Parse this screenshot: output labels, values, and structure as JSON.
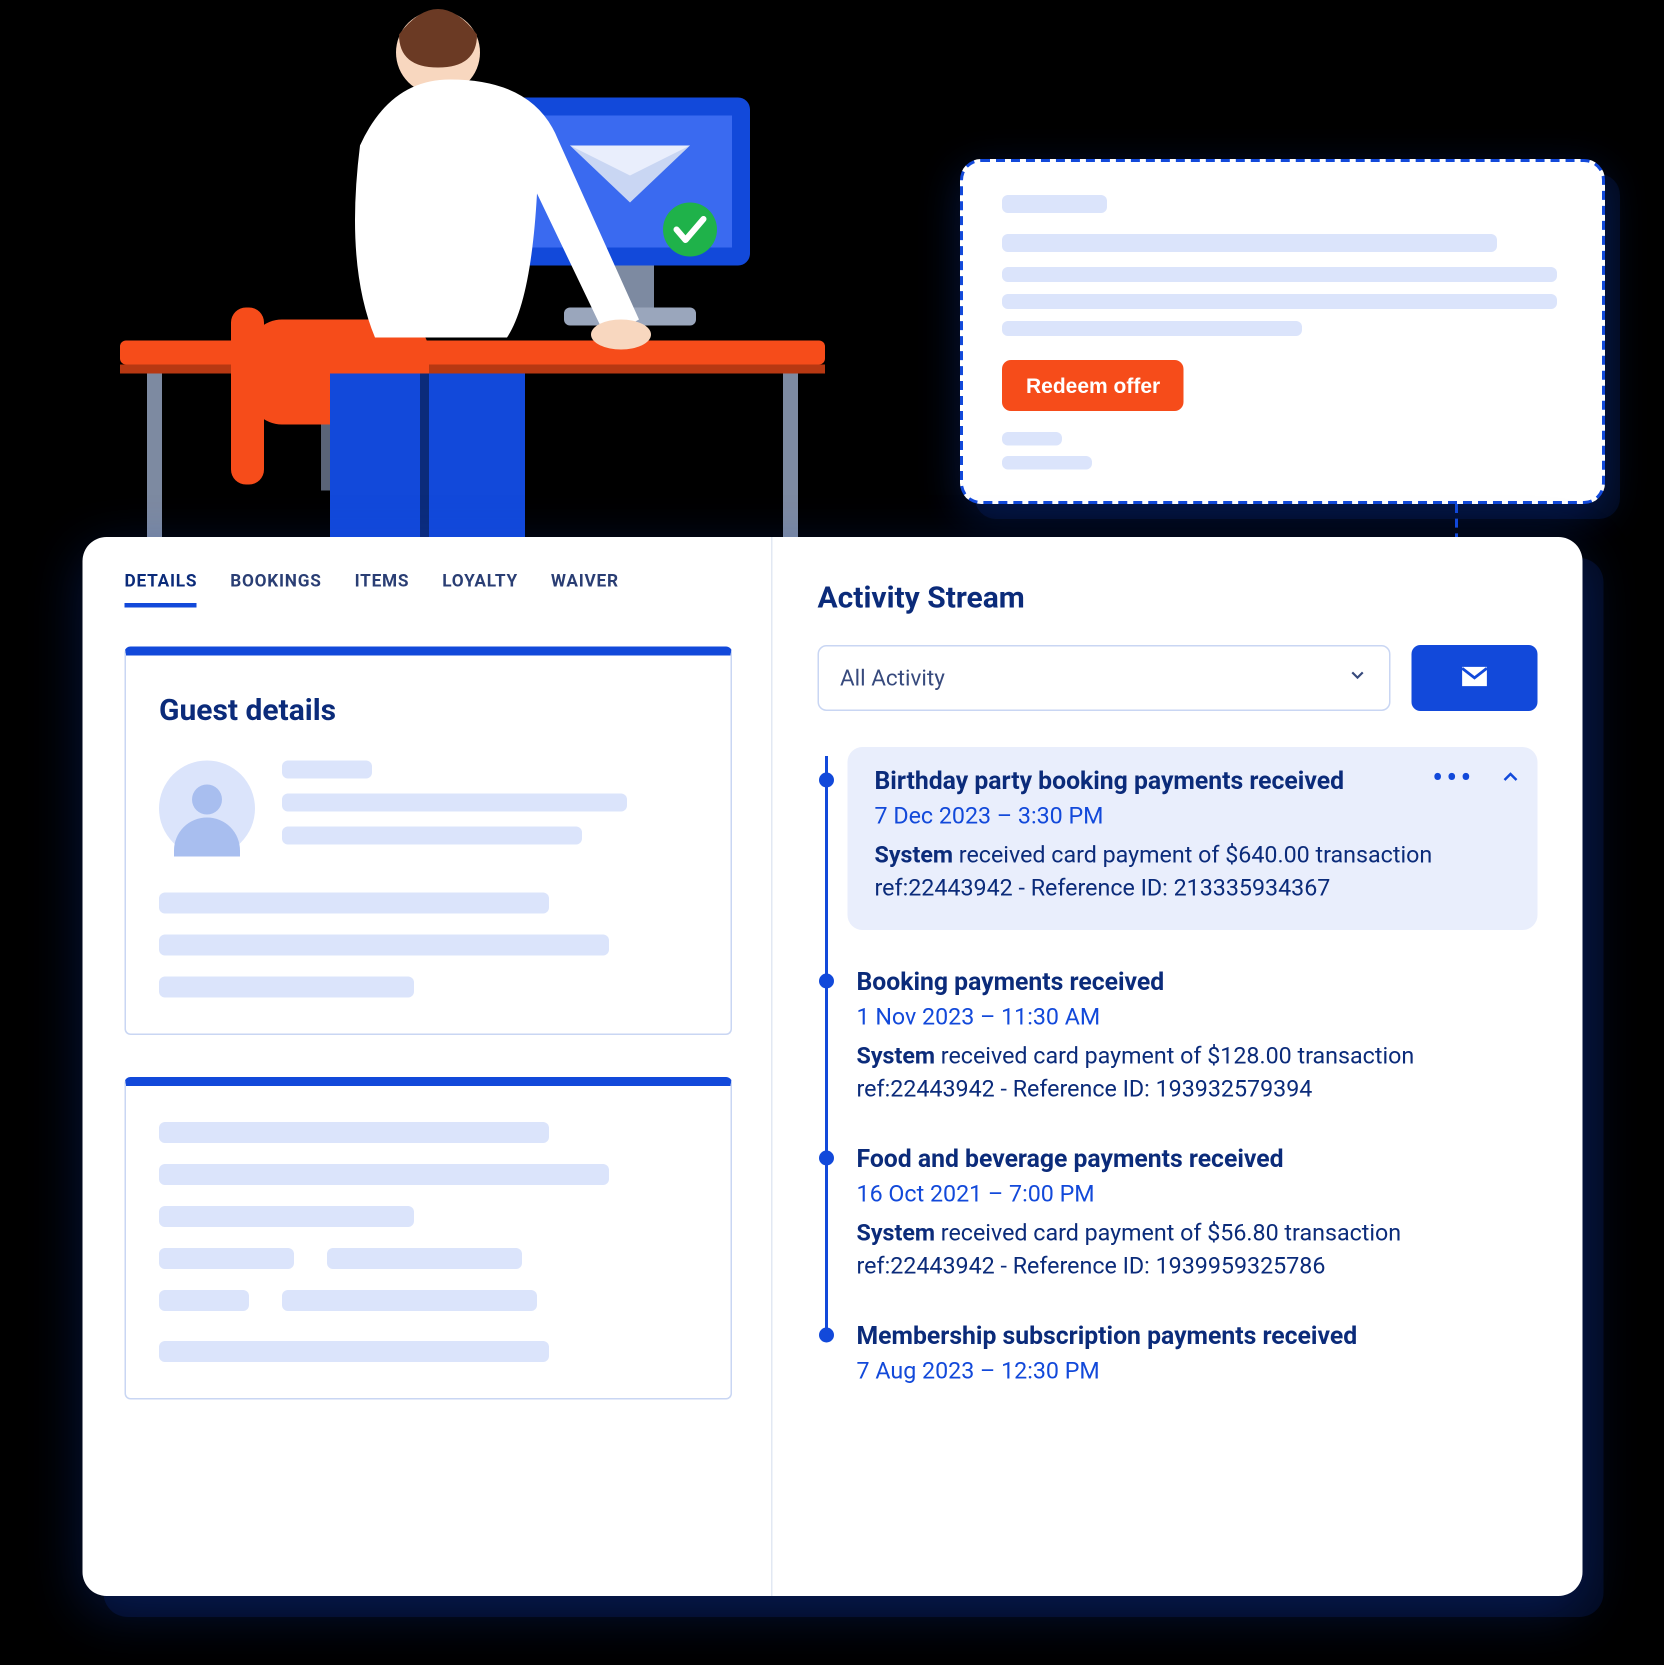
{
  "offer": {
    "button_label": "Redeem offer"
  },
  "tabs": [
    "DETAILS",
    "BOOKINGS",
    "ITEMS",
    "LOYALTY",
    "WAIVER"
  ],
  "active_tab_index": 0,
  "guest_details": {
    "title": "Guest details"
  },
  "activity": {
    "title": "Activity Stream",
    "filter": "All Activity",
    "events": [
      {
        "title": "Birthday party booking payments received",
        "date": "7 Dec 2023 – 3:30 PM",
        "actor": "System",
        "body_rest": " received card payment of $640.00 transaction ref:22443942 - Reference ID: 213335934367",
        "expanded": true
      },
      {
        "title": "Booking payments received",
        "date": "1 Nov 2023 – 11:30 AM",
        "actor": "System",
        "body_rest": " received card payment of $128.00 transaction ref:22443942 - Reference ID: 193932579394",
        "expanded": false
      },
      {
        "title": " Food and beverage payments received",
        "date": "16 Oct 2021 – 7:00 PM",
        "actor": "System",
        "body_rest": " received card payment of $56.80 transaction ref:22443942 - Reference ID: 1939959325786",
        "expanded": false
      },
      {
        "title": " Membership subscription payments received",
        "date": "7 Aug 2023 – 12:30 PM",
        "actor": "",
        "body_rest": "",
        "expanded": false
      }
    ]
  },
  "colors": {
    "primary": "#1249da",
    "accent": "#f64c1a",
    "text_dark": "#0b2b7a"
  }
}
